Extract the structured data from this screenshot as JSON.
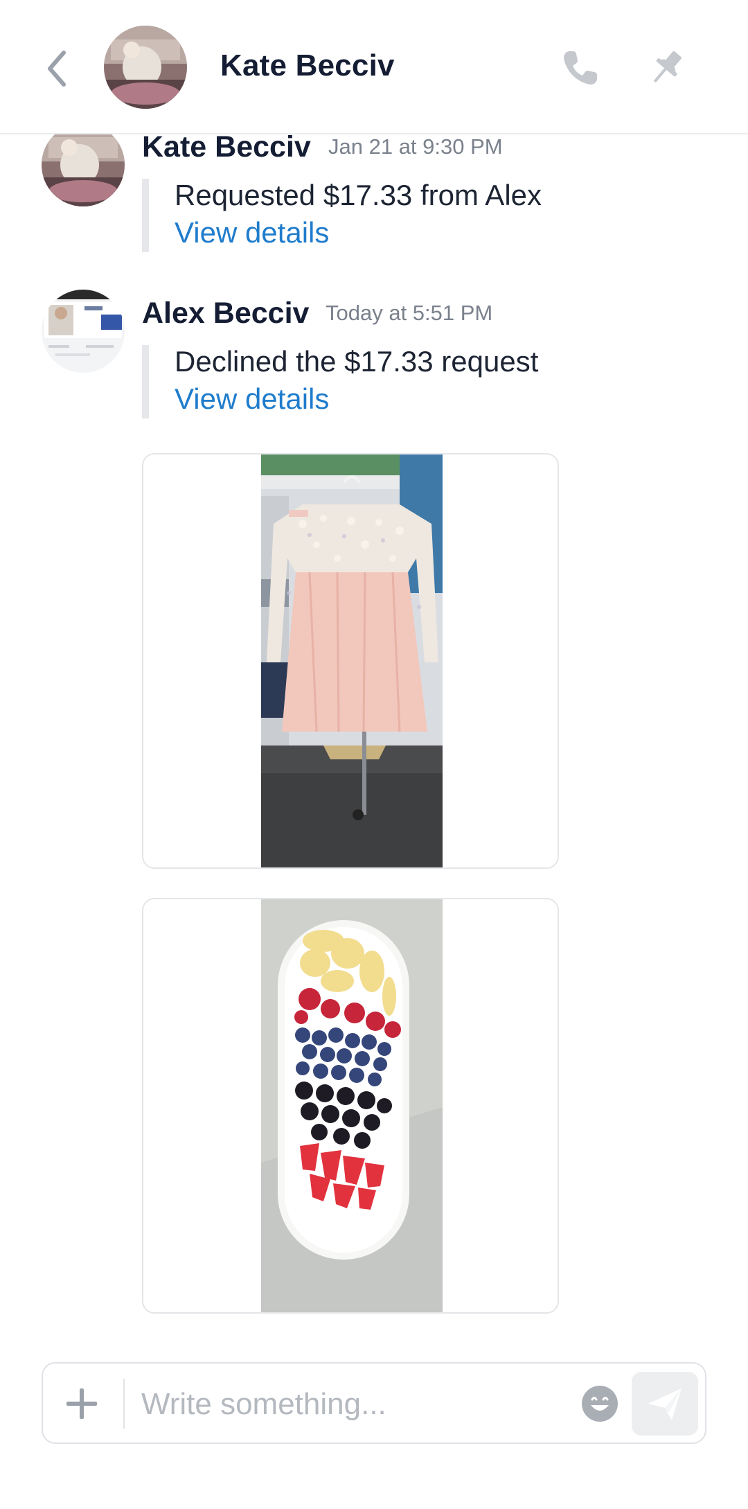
{
  "header": {
    "contact_name": "Kate Becciv"
  },
  "messages": [
    {
      "sender": "Kate Becciv",
      "time": "Jan 21 at 9:30 PM",
      "text": "Requested $17.33 from Alex",
      "link": "View details"
    },
    {
      "sender": "Alex Becciv",
      "time": "Today at 5:51 PM",
      "text": "Declined the $17.33 request",
      "link": "View details"
    }
  ],
  "composer": {
    "placeholder": "Write something..."
  },
  "icons": {
    "back": "chevron-left-icon",
    "call": "phone-icon",
    "pin": "pin-icon",
    "add": "plus-icon",
    "emoji": "smiley-icon",
    "send": "send-icon"
  },
  "colors": {
    "link": "#1f7ccc",
    "name": "#141d33",
    "muted": "#7a818c"
  }
}
